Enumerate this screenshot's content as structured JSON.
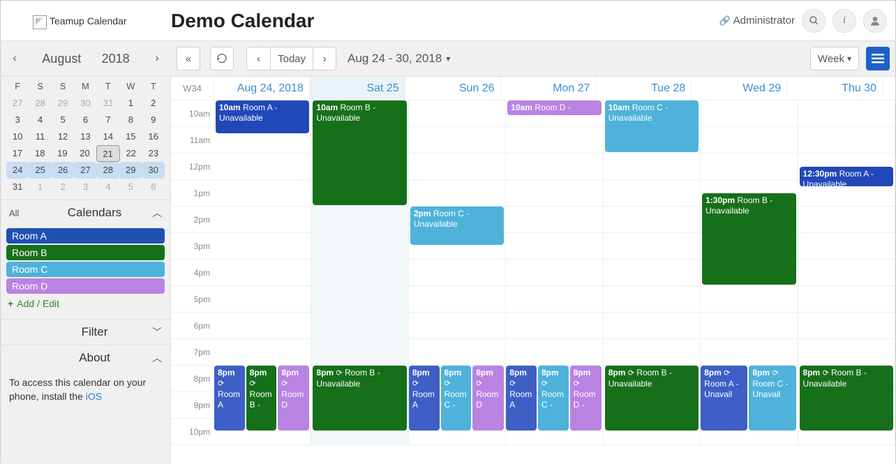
{
  "header": {
    "logo_text": "Teamup Calendar",
    "title": "Demo Calendar",
    "admin_label": "Administrator"
  },
  "toolbar": {
    "month": "August",
    "year": "2018",
    "today_label": "Today",
    "date_range": "Aug 24 - 30, 2018",
    "view_label": "Week"
  },
  "mini_cal": {
    "dow": [
      "F",
      "S",
      "S",
      "M",
      "T",
      "W",
      "T"
    ],
    "rows": [
      [
        {
          "n": "27",
          "m": true
        },
        {
          "n": "28",
          "m": true
        },
        {
          "n": "29",
          "m": true
        },
        {
          "n": "30",
          "m": true
        },
        {
          "n": "31",
          "m": true
        },
        {
          "n": "1"
        },
        {
          "n": "2"
        }
      ],
      [
        {
          "n": "3"
        },
        {
          "n": "4"
        },
        {
          "n": "5"
        },
        {
          "n": "6"
        },
        {
          "n": "7"
        },
        {
          "n": "8"
        },
        {
          "n": "9"
        }
      ],
      [
        {
          "n": "10"
        },
        {
          "n": "11"
        },
        {
          "n": "12"
        },
        {
          "n": "13"
        },
        {
          "n": "14"
        },
        {
          "n": "15"
        },
        {
          "n": "16"
        }
      ],
      [
        {
          "n": "17"
        },
        {
          "n": "18"
        },
        {
          "n": "19"
        },
        {
          "n": "20"
        },
        {
          "n": "21",
          "today": true
        },
        {
          "n": "22"
        },
        {
          "n": "23"
        }
      ],
      [
        {
          "n": "24",
          "sel": true
        },
        {
          "n": "25",
          "sel": true
        },
        {
          "n": "26",
          "sel": true
        },
        {
          "n": "27",
          "sel": true
        },
        {
          "n": "28",
          "sel": true
        },
        {
          "n": "29",
          "sel": true
        },
        {
          "n": "30",
          "sel": true
        }
      ],
      [
        {
          "n": "31"
        },
        {
          "n": "1",
          "m": true
        },
        {
          "n": "2",
          "m": true
        },
        {
          "n": "3",
          "m": true
        },
        {
          "n": "4",
          "m": true
        },
        {
          "n": "5",
          "m": true
        },
        {
          "n": "6",
          "m": true
        }
      ]
    ]
  },
  "sidebar": {
    "all_label": "All",
    "calendars_label": "Calendars",
    "calendars": [
      {
        "name": "Room A",
        "cls": "room-a"
      },
      {
        "name": "Room B",
        "cls": "room-b"
      },
      {
        "name": "Room C",
        "cls": "room-c"
      },
      {
        "name": "Room D",
        "cls": "room-d"
      }
    ],
    "add_edit_label": "Add / Edit",
    "filter_label": "Filter",
    "about_label": "About",
    "about_note_pre": "To access this calendar on your phone, install the ",
    "about_note_link": "iOS"
  },
  "grid": {
    "week_label": "W34",
    "days": [
      "Aug 24, 2018",
      "Sat 25",
      "Sun 26",
      "Mon 27",
      "Tue 28",
      "Wed 29",
      "Thu 30"
    ],
    "today_index": 1,
    "hours": [
      "10am",
      "11am",
      "12pm",
      "1pm",
      "2pm",
      "3pm",
      "4pm",
      "5pm",
      "6pm",
      "7pm",
      "8pm",
      "9pm",
      "10pm"
    ]
  },
  "events": [
    {
      "day": 0,
      "startH": 10,
      "endH": 11.3,
      "cls": "room-a",
      "time": "10am",
      "title": "Room A - Unavailable"
    },
    {
      "day": 1,
      "startH": 10,
      "endH": 14,
      "cls": "room-b",
      "time": "10am",
      "title": "Room B - Unavailable"
    },
    {
      "day": 3,
      "startH": 10,
      "endH": 10.6,
      "cls": "room-d",
      "time": "10am",
      "title": "Room D - Unavailable"
    },
    {
      "day": 4,
      "startH": 10,
      "endH": 12,
      "cls": "room-c",
      "time": "10am",
      "title": "Room C - Unavailable"
    },
    {
      "day": 6,
      "startH": 12.5,
      "endH": 13.3,
      "cls": "room-a",
      "time": "12:30pm",
      "title": "Room A - Unavailable"
    },
    {
      "day": 5,
      "startH": 13.5,
      "endH": 17,
      "cls": "room-b",
      "time": "1:30pm",
      "title": "Room B - Unavailable"
    },
    {
      "day": 2,
      "startH": 14,
      "endH": 15.5,
      "cls": "room-c",
      "time": "2pm",
      "title": "Room C - Unavailable"
    },
    {
      "day": 0,
      "startH": 20,
      "endH": 22.5,
      "cls": "room-a2",
      "time": "8pm",
      "title": "Room A",
      "recurring": true,
      "leftPct": 0,
      "widthPct": 33
    },
    {
      "day": 0,
      "startH": 20,
      "endH": 22.5,
      "cls": "room-b",
      "time": "8pm",
      "title": "Room B -",
      "recurring": true,
      "leftPct": 33,
      "widthPct": 33
    },
    {
      "day": 0,
      "startH": 20,
      "endH": 22.5,
      "cls": "room-d",
      "time": "8pm",
      "title": "Room D",
      "recurring": true,
      "leftPct": 66,
      "widthPct": 34
    },
    {
      "day": 1,
      "startH": 20,
      "endH": 22.5,
      "cls": "room-b",
      "time": "8pm",
      "title": "Room B - Unavailable",
      "recurring": true
    },
    {
      "day": 2,
      "startH": 20,
      "endH": 22.5,
      "cls": "room-a2",
      "time": "8pm",
      "title": "Room A",
      "recurring": true,
      "leftPct": 0,
      "widthPct": 33
    },
    {
      "day": 2,
      "startH": 20,
      "endH": 22.5,
      "cls": "room-c",
      "time": "8pm",
      "title": "Room C -",
      "recurring": true,
      "leftPct": 33,
      "widthPct": 33
    },
    {
      "day": 2,
      "startH": 20,
      "endH": 22.5,
      "cls": "room-d",
      "time": "8pm",
      "title": "Room D",
      "recurring": true,
      "leftPct": 66,
      "widthPct": 34
    },
    {
      "day": 3,
      "startH": 20,
      "endH": 22.5,
      "cls": "room-a2",
      "time": "8pm",
      "title": "Room A",
      "recurring": true,
      "leftPct": 0,
      "widthPct": 33
    },
    {
      "day": 3,
      "startH": 20,
      "endH": 22.5,
      "cls": "room-c",
      "time": "8pm",
      "title": "Room C -",
      "recurring": true,
      "leftPct": 33,
      "widthPct": 33
    },
    {
      "day": 3,
      "startH": 20,
      "endH": 22.5,
      "cls": "room-d",
      "time": "8pm",
      "title": "Room D -",
      "recurring": true,
      "leftPct": 66,
      "widthPct": 34
    },
    {
      "day": 4,
      "startH": 20,
      "endH": 22.5,
      "cls": "room-b",
      "time": "8pm",
      "title": "Room B - Unavailable",
      "recurring": true
    },
    {
      "day": 5,
      "startH": 20,
      "endH": 22.5,
      "cls": "room-a2",
      "time": "8pm",
      "title": "Room A - Unavail",
      "recurring": true,
      "leftPct": 0,
      "widthPct": 50
    },
    {
      "day": 5,
      "startH": 20,
      "endH": 22.5,
      "cls": "room-c",
      "time": "8pm",
      "title": "Room C - Unavail",
      "recurring": true,
      "leftPct": 50,
      "widthPct": 50
    },
    {
      "day": 6,
      "startH": 20,
      "endH": 22.5,
      "cls": "room-b",
      "time": "8pm",
      "title": "Room B - Unavailable",
      "recurring": true
    }
  ]
}
